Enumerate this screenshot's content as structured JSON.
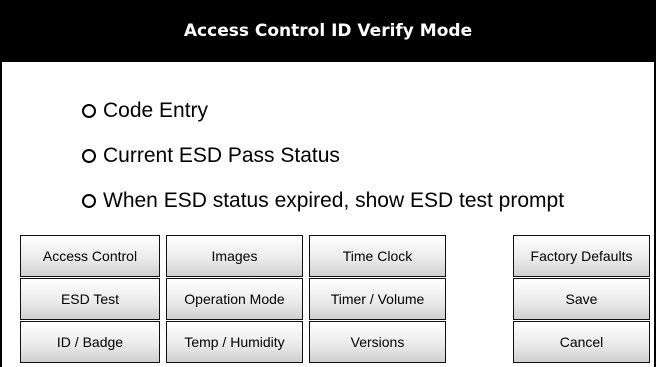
{
  "header": {
    "title": "Access Control ID Verify Mode"
  },
  "options": [
    {
      "label": "Code Entry",
      "selected": false
    },
    {
      "label": "Current ESD Pass Status",
      "selected": false
    },
    {
      "label": "When ESD status expired, show ESD test prompt",
      "selected": false
    }
  ],
  "buttons": {
    "access_control": "Access Control",
    "images": "Images",
    "time_clock": "Time Clock",
    "factory_defaults": "Factory Defaults",
    "esd_test": "ESD Test",
    "operation_mode": "Operation Mode",
    "timer_volume": "Timer / Volume",
    "save": "Save",
    "id_badge": "ID / Badge",
    "temp_humidity": "Temp / Humidity",
    "versions": "Versions",
    "cancel": "Cancel"
  },
  "colors": {
    "title_bg": "#000000",
    "title_text": "#ffffff",
    "background": "#ffffff"
  }
}
